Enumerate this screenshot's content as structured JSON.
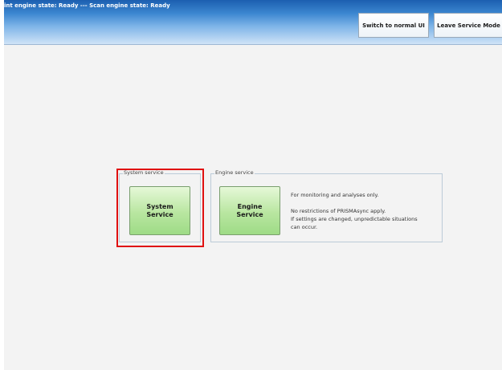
{
  "header": {
    "status": "int engine state: Ready --- Scan engine state: Ready",
    "switch_label": "Switch to normal UI",
    "leave_label": "Leave Service Mode"
  },
  "system_group": {
    "legend": "System service",
    "button_line1": "System",
    "button_line2": "Service"
  },
  "engine_group": {
    "legend": "Engine service",
    "button_line1": "Engine",
    "button_line2": "Service",
    "info": [
      "For monitoring and analyses only.",
      "No restrictions of PRISMAsync apply.",
      "If settings are changed, unpredictable situations",
      "can occur."
    ]
  },
  "colors": {
    "header": "#3b86d0",
    "button_green": "#b8e6a0",
    "highlight": "#e01010"
  }
}
